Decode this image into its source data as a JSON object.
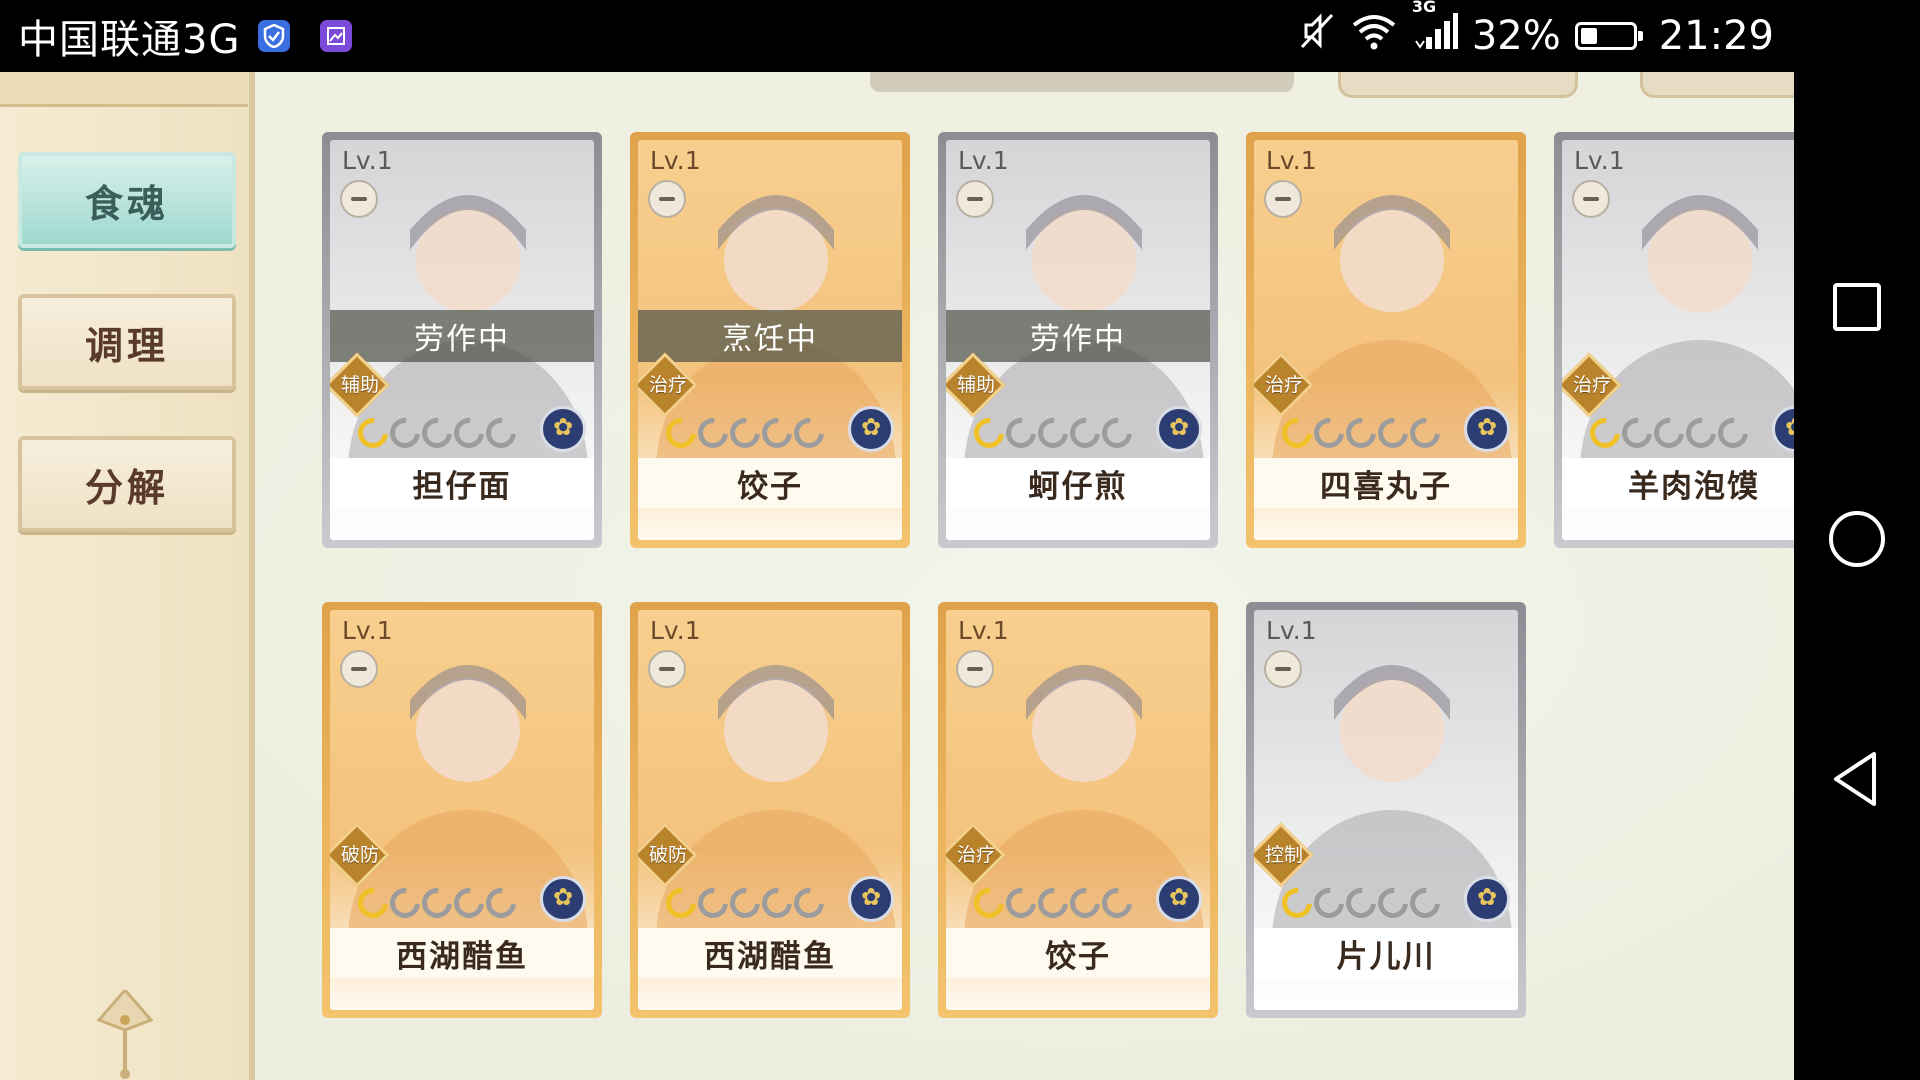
{
  "status_bar": {
    "carrier": "中国联通3G",
    "network_type": "3G",
    "battery_percent": "32%",
    "battery_level": 0.32,
    "time": "21:29"
  },
  "side_menu": {
    "items": [
      {
        "label": "食魂",
        "active": true
      },
      {
        "label": "调理",
        "active": false
      },
      {
        "label": "分解",
        "active": false
      }
    ]
  },
  "cards": [
    {
      "level": "Lv.1",
      "name": "担仔面",
      "role": "辅助",
      "status": "劳作中",
      "stars": 1,
      "rarity": "silver"
    },
    {
      "level": "Lv.1",
      "name": "饺子",
      "role": "治疗",
      "status": "烹饪中",
      "stars": 1,
      "rarity": "gold"
    },
    {
      "level": "Lv.1",
      "name": "蚵仔煎",
      "role": "辅助",
      "status": "劳作中",
      "stars": 1,
      "rarity": "silver"
    },
    {
      "level": "Lv.1",
      "name": "四喜丸子",
      "role": "治疗",
      "status": "",
      "stars": 1,
      "rarity": "gold"
    },
    {
      "level": "Lv.1",
      "name": "羊肉泡馍",
      "role": "治疗",
      "status": "",
      "stars": 1,
      "rarity": "silver"
    },
    {
      "level": "Lv.1",
      "name": "西湖醋鱼",
      "role": "破防",
      "status": "",
      "stars": 1,
      "rarity": "gold"
    },
    {
      "level": "Lv.1",
      "name": "西湖醋鱼",
      "role": "破防",
      "status": "",
      "stars": 1,
      "rarity": "gold"
    },
    {
      "level": "Lv.1",
      "name": "饺子",
      "role": "治疗",
      "status": "",
      "stars": 1,
      "rarity": "gold"
    },
    {
      "level": "Lv.1",
      "name": "片儿川",
      "role": "控制",
      "status": "",
      "stars": 1,
      "rarity": "silver"
    }
  ]
}
